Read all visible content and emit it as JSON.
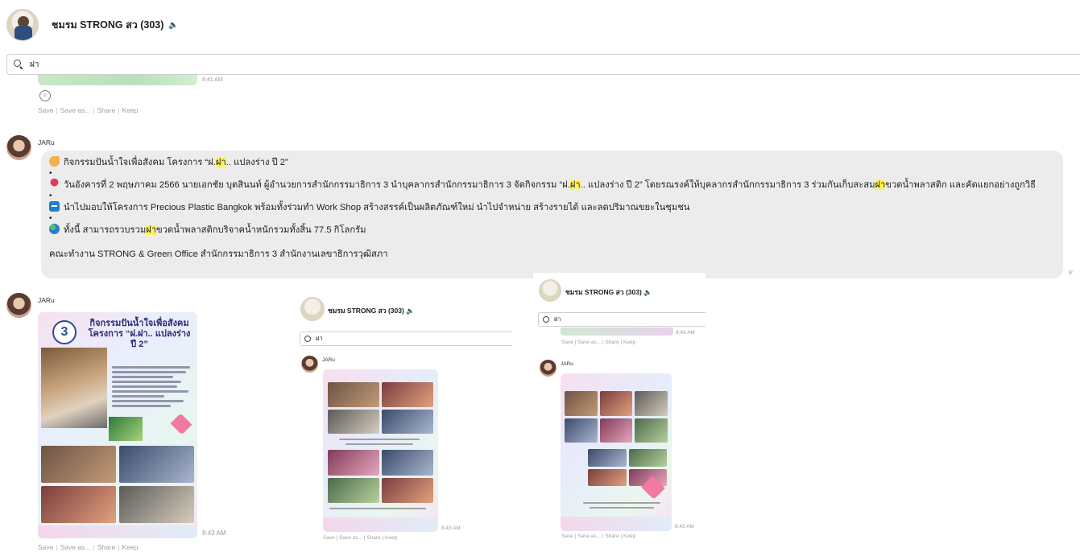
{
  "header": {
    "group_name": "ชมรม STRONG สว (303)",
    "mute_icon": "speaker-mute-icon"
  },
  "search": {
    "value": "ฝา"
  },
  "previous": {
    "time": "8:41 AM",
    "reaction_icon": "reaction-icon"
  },
  "message_actions": {
    "save": "Save",
    "save_as": "Save as...",
    "share": "Share",
    "keep": "Keep"
  },
  "messages": [
    {
      "sender": "JARu",
      "text_lines": {
        "l1_pre": "กิจกรรมปันน้ำใจเพื่อสังคม โครงการ “ฝ.",
        "l1_hl": "ฝา",
        "l1_post": ".. แปลงร่าง ปี 2”",
        "l2_pre": "วันอังคารที่ 2 พฤษภาคม 2566 นายเอกชัย บุตสินนท์ ผู้อำนวยการสำนักกรรมาธิการ 3  นำบุคลากรสำนักกรรมาธิการ 3 จัดกิจกรรม “ฝ.",
        "l2_hl1": "ฝา",
        "l2_mid": ".. แปลงร่าง ปี 2” โดยรณรงค์ให้บุคลากรสำนักกรรมาธิการ 3 ร่วมกันเก็บสะสม",
        "l2_hl2": "ฝา",
        "l2_post": "ขวดน้ำพลาสติก และคัดแยกอย่างถูกวิธี",
        "l3": "นำไปมอบให้โครงการ Precious Plastic Bangkok พร้อมทั้งร่วมทำ Work Shop สร้างสรรค์เป็นผลิตภัณฑ์ใหม่ นำไปจำหน่าย สร้างรายได้ และลดปริมาณขยะในชุมชน",
        "l4_pre": "ทั้งนี้ สามารถรวบรวม",
        "l4_hl": "ฝา",
        "l4_post": "ขวดน้ำพลาสติกบริจาคน้ำหนักรวมทั้งสิ้น 77.5 กิโลกรัม",
        "l5": "คณะทำงาน STRONG & Green Office สำนักกรรมาธิการ 3 สำนักงานเลขาธิการวุฒิสภา",
        "dot": "•"
      },
      "side_time": "8:"
    },
    {
      "sender": "JARu",
      "poster_logo": "3",
      "poster_title": "กิจกรรมปันน้ำใจเพื่อสังคม โครงการ “ฝ.ฝา.. แปลงร่าง ปี 2”",
      "time": "8:43 AM"
    }
  ],
  "embedded_1": {
    "group_name": "ชมรม STRONG สว (303)",
    "search_value": "ฝา",
    "sender": "JARu",
    "time": "8:43 AM"
  },
  "embedded_2": {
    "group_name": "ชมรม STRONG สว (303)",
    "search_value": "ฝา",
    "prev_time": "8:43 AM",
    "sender": "JARu",
    "time": "8:43 AM"
  },
  "colors": {
    "highlight": "#fff45c",
    "bubble_bg": "#ececec",
    "muted_text": "#a0a0a0"
  }
}
